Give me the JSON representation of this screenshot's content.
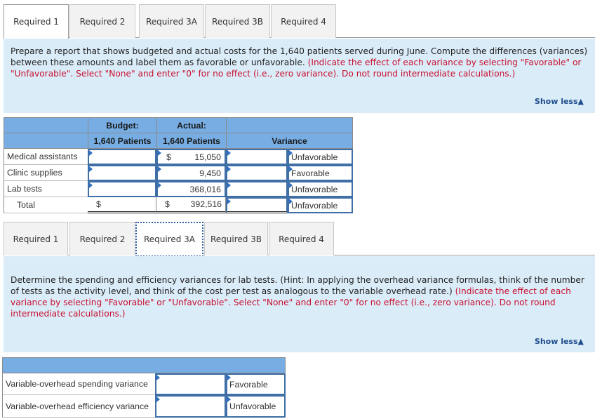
{
  "tabs_top": {
    "items": [
      {
        "label": "Required 1",
        "state": "active"
      },
      {
        "label": "Required 2",
        "state": "inactive"
      },
      {
        "label": "Required 3A",
        "state": "inactive"
      },
      {
        "label": "Required 3B",
        "state": "inactive"
      },
      {
        "label": "Required 4",
        "state": "inactive"
      }
    ]
  },
  "req1": {
    "instructions": "Prepare a report that shows budgeted and actual costs for the 1,640 patients served during June. Compute the differences (variances) between these amounts and label them as favorable or unfavorable.",
    "note": "(Indicate the effect of each variance by selecting \"Favorable\" or \"Unfavorable\". Select \"None\" and enter \"0\" for no effect (i.e., zero variance). Do not round intermediate calculations.)",
    "show_less": "Show less",
    "show_less_icon": "triangle-up-icon",
    "headers": {
      "budget_line1": "Budget:",
      "budget_line2": "1,640 Patients",
      "actual_line1": "Actual:",
      "actual_line2": "1,640 Patients",
      "variance": "Variance"
    },
    "rows": [
      {
        "label": "Medical assistants",
        "budget": "",
        "actual_dollar": "$",
        "actual": "15,050",
        "variance": "",
        "effect": "Unfavorable"
      },
      {
        "label": "Clinic supplies",
        "budget": "",
        "actual_dollar": "",
        "actual": "9,450",
        "variance": "",
        "effect": "Favorable"
      },
      {
        "label": "Lab tests",
        "budget": "",
        "actual_dollar": "",
        "actual": "368,016",
        "variance": "",
        "effect": "Unfavorable"
      }
    ],
    "total": {
      "label": "Total",
      "budget_dollar": "$",
      "budget": "",
      "actual_dollar": "$",
      "actual": "392,516",
      "variance": "",
      "effect": "Unfavorable"
    }
  },
  "tabs_bottom": {
    "items": [
      {
        "label": "Required 1",
        "state": "inactive"
      },
      {
        "label": "Required 2",
        "state": "inactive"
      },
      {
        "label": "Required 3A",
        "state": "active-focused"
      },
      {
        "label": "Required 3B",
        "state": "inactive"
      },
      {
        "label": "Required 4",
        "state": "inactive"
      }
    ]
  },
  "req3a": {
    "instructions": "Determine the spending and efficiency variances for lab tests. (Hint: In applying the overhead variance formulas, think of the number of tests as the activity level, and think of the cost per test as analogous to the variable overhead rate.)",
    "note": "(Indicate the effect of each variance by selecting \"Favorable\" or \"Unfavorable\". Select \"None\" and enter \"0\" for no effect (i.e., zero variance). Do not round intermediate calculations.)",
    "show_less": "Show less",
    "show_less_icon": "triangle-up-icon",
    "rows": [
      {
        "label": "Variable-overhead spending variance",
        "amount": "",
        "effect": "Favorable"
      },
      {
        "label": "Variable-overhead efficiency variance",
        "amount": "",
        "effect": "Unfavorable"
      }
    ]
  }
}
